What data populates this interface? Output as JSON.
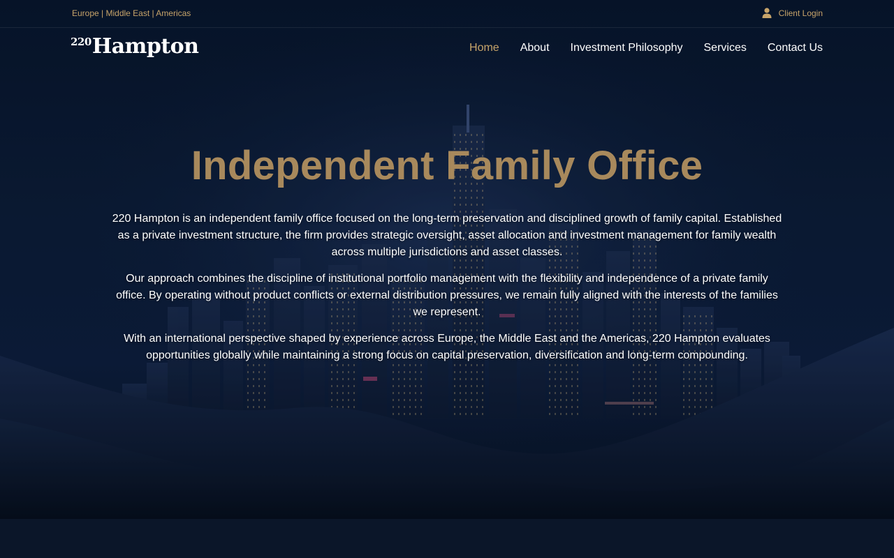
{
  "topbar": {
    "regions": "Europe | Middle East | Americas",
    "client_login": "Client Login",
    "login_icon": "user-icon"
  },
  "logo": {
    "number": "220",
    "word": "Hampton"
  },
  "nav": {
    "items": [
      {
        "label": "Home",
        "active": true
      },
      {
        "label": "About"
      },
      {
        "label": "Investment Philosophy"
      },
      {
        "label": "Services"
      },
      {
        "label": "Contact Us"
      }
    ]
  },
  "hero": {
    "title": "Independent Family Office",
    "paragraphs": [
      "220 Hampton is an independent family office focused on the long-term preservation and disciplined growth of family capital. Established as a private investment structure, the firm provides strategic oversight, asset allocation and investment management for family wealth across multiple jurisdictions and asset classes.",
      "Our approach combines the discipline of institutional portfolio management with the flexibility and independence of a private family office. By operating without product conflicts or external distribution pressures, we remain fully aligned with the interests of the families we represent.",
      "With an international perspective shaped by experience across Europe, the Middle East and the Americas, 220 Hampton evaluates opportunities globally while maintaining a strong focus on capital preservation, diversification and long-term compounding."
    ]
  },
  "colors": {
    "accent_gold": "#c7a46a",
    "headline_gold": "#a8895c",
    "background": "#0a1529"
  }
}
